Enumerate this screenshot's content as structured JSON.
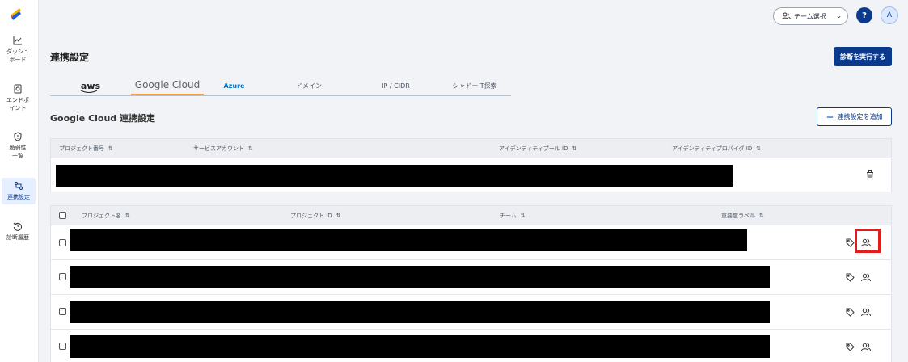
{
  "sidebar": {
    "items": [
      {
        "label": "ダッシュボード",
        "icon": "chart-line-icon"
      },
      {
        "label": "エンドポイント",
        "icon": "endpoint-icon"
      },
      {
        "label": "脆弱性一覧",
        "icon": "shield-icon"
      },
      {
        "label": "連携設定",
        "icon": "integration-icon"
      },
      {
        "label": "診断履歴",
        "icon": "history-icon"
      }
    ]
  },
  "header": {
    "team_select_label": "チーム選択",
    "help_label": "?",
    "avatar_initial": "A"
  },
  "page": {
    "title": "連携設定",
    "run_button_label": "診断を実行する"
  },
  "tabs": [
    {
      "label": "aws"
    },
    {
      "label": "Google Cloud"
    },
    {
      "label": "Azure"
    },
    {
      "label": "ドメイン"
    },
    {
      "label": "IP / CIDR"
    },
    {
      "label": "シャドーIT探索"
    }
  ],
  "section": {
    "title": "Google Cloud 連携設定",
    "add_button_label": "連携設定を追加"
  },
  "config_table": {
    "headers": [
      "プロジェクト番号",
      "サービスアカウント",
      "アイデンティティプール ID",
      "アイデンティティプロバイダ ID"
    ],
    "sort_glyph": "⇅"
  },
  "project_table": {
    "headers": [
      "プロジェクト名",
      "プロジェクト ID",
      "チーム",
      "重要度ラベル"
    ],
    "sort_glyph": "⇅",
    "row_count": 4
  },
  "colors": {
    "primary": "#0b3a8c",
    "tab_active": "#ff9d3a",
    "highlight": "#e11d1d"
  }
}
